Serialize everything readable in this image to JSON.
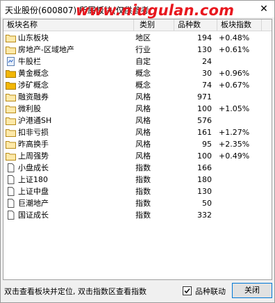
{
  "window": {
    "title": "天业股份(600807) 所属板块(仅供参考",
    "watermark": "www.niugulan.com",
    "close_glyph": "✕"
  },
  "table": {
    "columns": [
      "板块名称",
      "类别",
      "品种数",
      "板块指数"
    ],
    "rows": [
      {
        "icon": "folder",
        "name": "山东板块",
        "type": "地区",
        "count": "194",
        "index": "+0.48%"
      },
      {
        "icon": "folder",
        "name": "房地产-区域地产",
        "type": "行业",
        "count": "130",
        "index": "+0.61%"
      },
      {
        "icon": "custom-stock",
        "name": "牛股栏",
        "type": "自定",
        "count": "24",
        "index": ""
      },
      {
        "icon": "folder-filled",
        "name": "黄金概念",
        "type": "概念",
        "count": "30",
        "index": "+0.96%"
      },
      {
        "icon": "folder-filled",
        "name": "涉矿概念",
        "type": "概念",
        "count": "74",
        "index": "+0.67%"
      },
      {
        "icon": "folder",
        "name": "融资融券",
        "type": "风格",
        "count": "971",
        "index": ""
      },
      {
        "icon": "folder",
        "name": "微利股",
        "type": "风格",
        "count": "100",
        "index": "+1.05%"
      },
      {
        "icon": "folder",
        "name": "沪港通SH",
        "type": "风格",
        "count": "576",
        "index": ""
      },
      {
        "icon": "folder",
        "name": "扣非亏损",
        "type": "风格",
        "count": "161",
        "index": "+1.27%"
      },
      {
        "icon": "folder",
        "name": "昨高换手",
        "type": "风格",
        "count": "95",
        "index": "+2.35%"
      },
      {
        "icon": "folder",
        "name": "上周强势",
        "type": "风格",
        "count": "100",
        "index": "+0.49%"
      },
      {
        "icon": "document",
        "name": "小盘成长",
        "type": "指数",
        "count": "166",
        "index": ""
      },
      {
        "icon": "document",
        "name": "上证180",
        "type": "指数",
        "count": "180",
        "index": ""
      },
      {
        "icon": "document",
        "name": "上证中盘",
        "type": "指数",
        "count": "130",
        "index": ""
      },
      {
        "icon": "document",
        "name": "巨潮地产",
        "type": "指数",
        "count": "50",
        "index": ""
      },
      {
        "icon": "document",
        "name": "国证成长",
        "type": "指数",
        "count": "332",
        "index": ""
      }
    ]
  },
  "status": {
    "hint": "双击查看板块并定位, 双击指数区查看指数",
    "linkage_label": "品种联动",
    "linkage_checked": true,
    "close_label": "关闭"
  },
  "colors": {
    "watermark": "#e8171e",
    "folder": "#e8b43a",
    "folder_filled": "#f2b705"
  }
}
